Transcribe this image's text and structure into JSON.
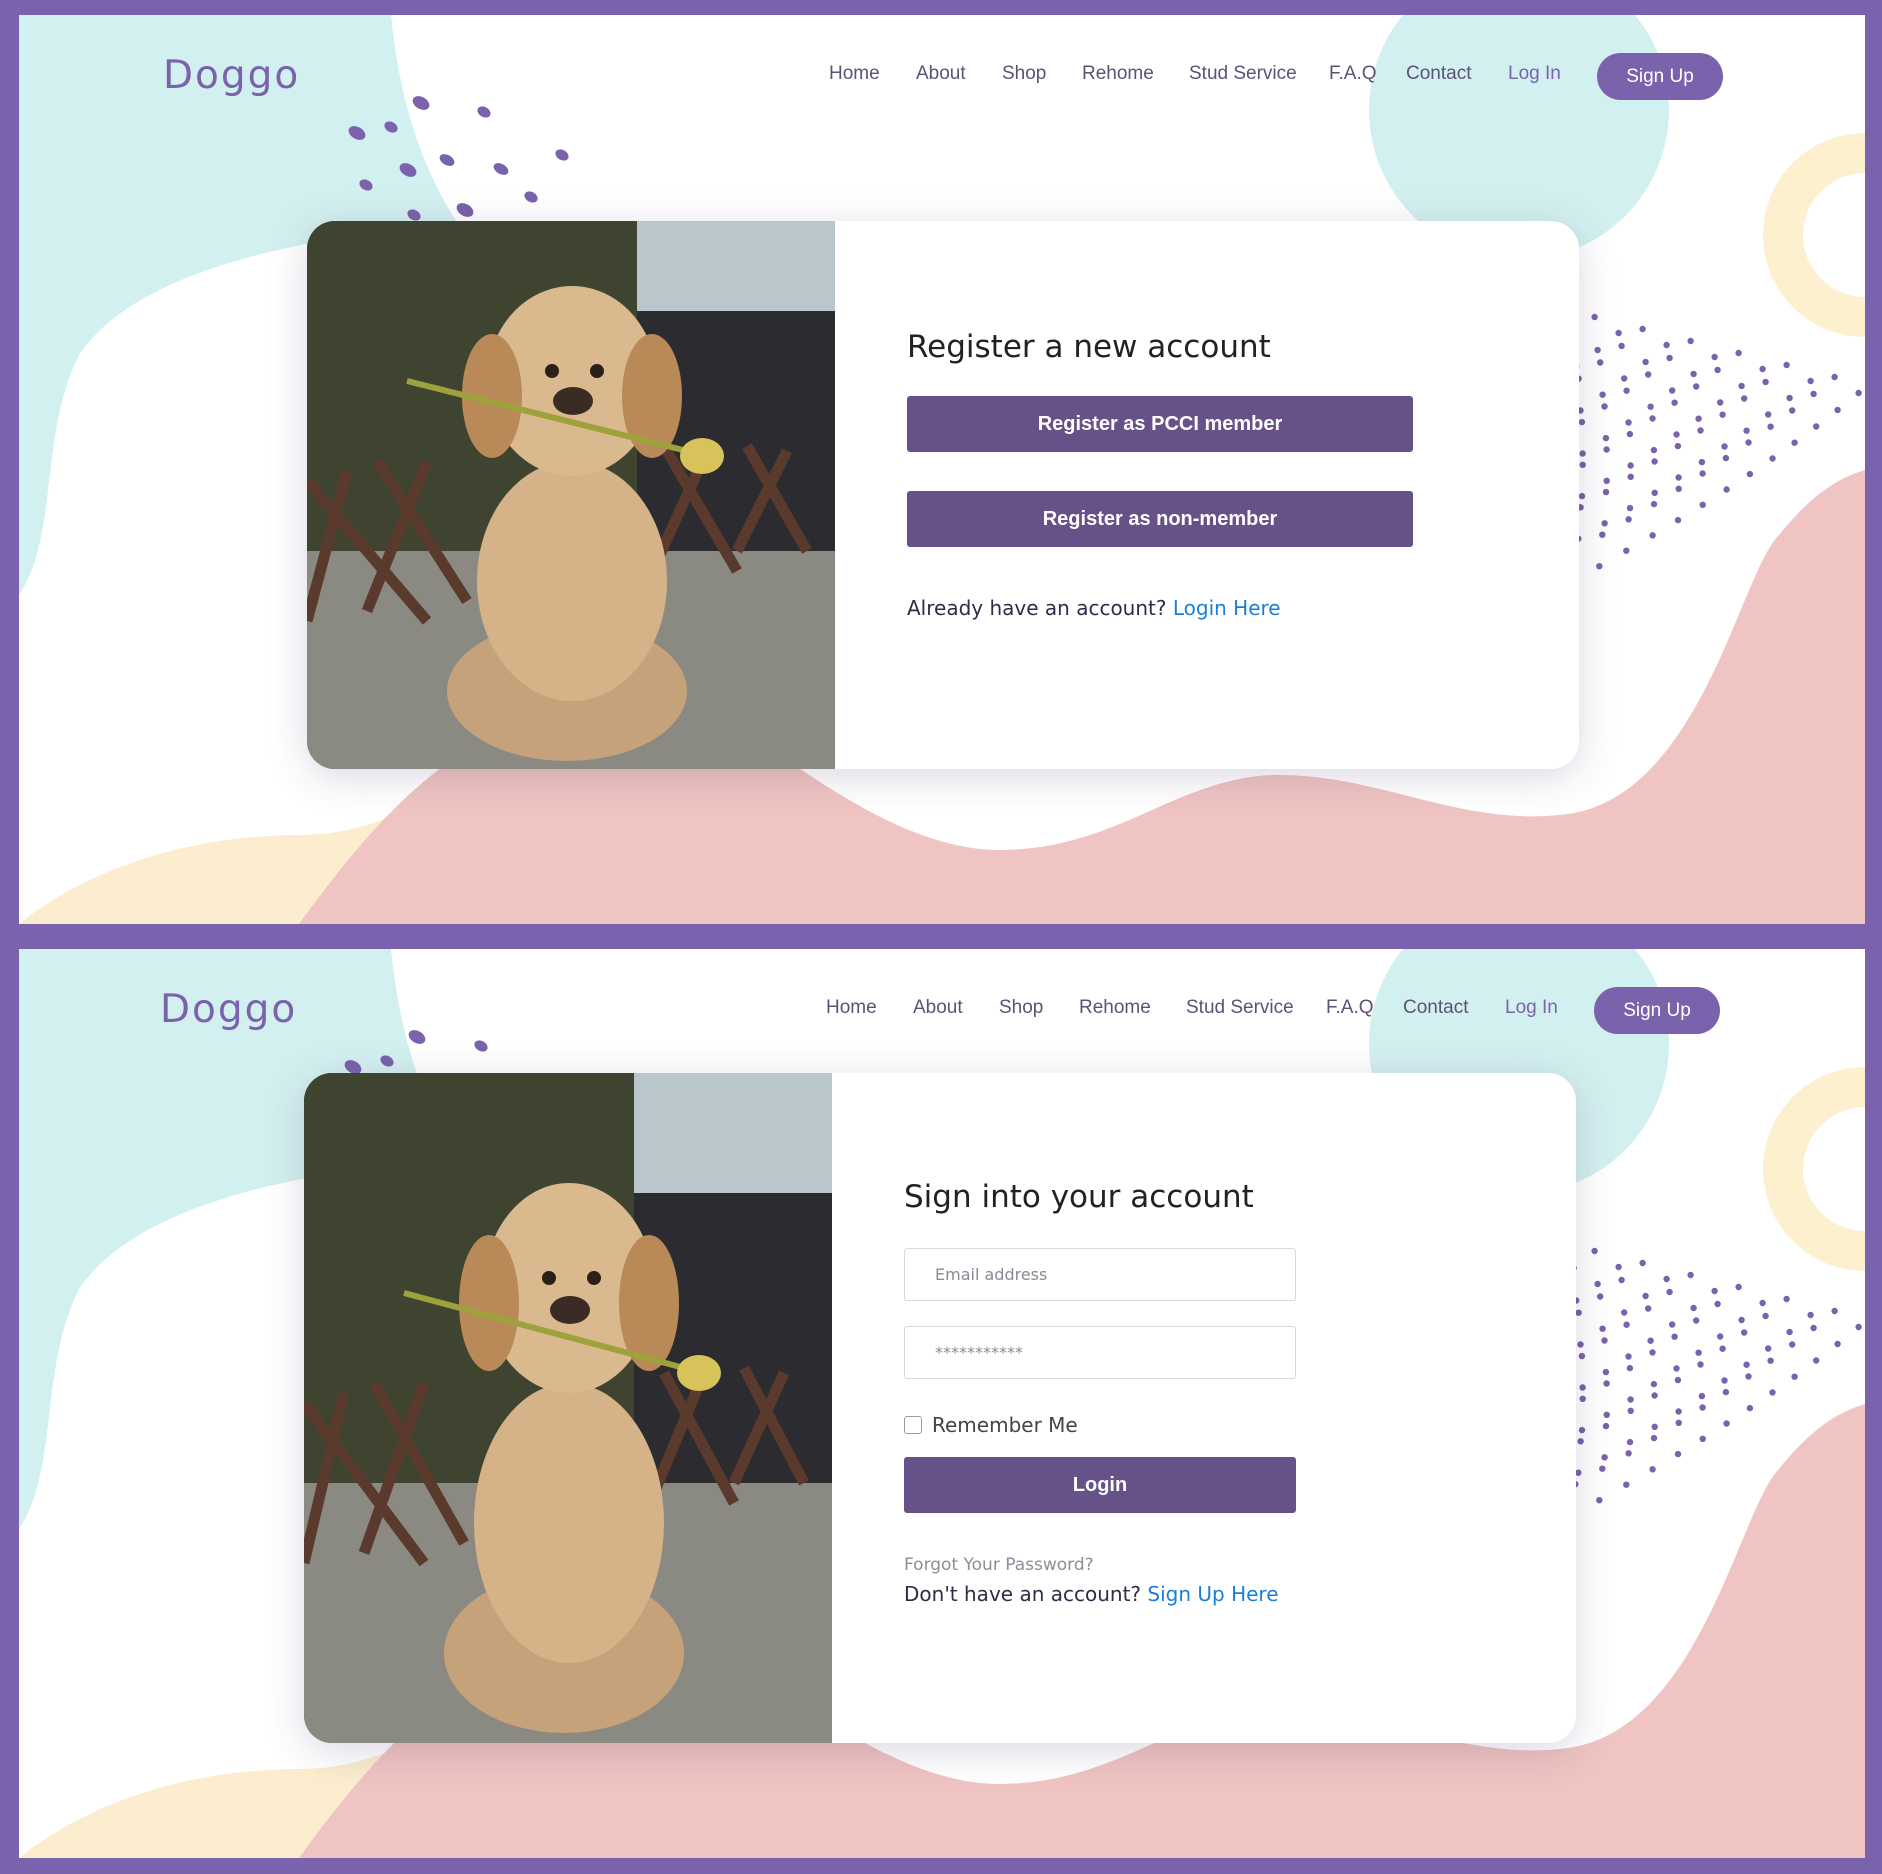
{
  "brand": {
    "logo": "Doggo",
    "primary_color": "#7a62ac",
    "button_color": "#665289",
    "link_color": "#1a7fd6"
  },
  "nav": {
    "items": [
      "Home",
      "About",
      "Shop",
      "Rehome",
      "Stud Service",
      "F.A.Q",
      "Contact"
    ],
    "login": "Log In",
    "signup": "Sign Up"
  },
  "register": {
    "title": "Register a new account",
    "member_button": "Register as PCCI member",
    "nonmember_button": "Register as non-member",
    "already_text": "Already have an account?",
    "login_link": "Login Here"
  },
  "signin": {
    "title": "Sign into your account",
    "email_placeholder": "Email address",
    "password_placeholder": "***********",
    "remember_label": "Remember Me",
    "login_button": "Login",
    "forgot_link": "Forgot Your Password?",
    "no_account_text": "Don't have an account?",
    "signup_link": "Sign Up Here"
  },
  "icons": {
    "remember_checkbox": "checkbox-icon",
    "dog_photo": "dog-photo-icon"
  }
}
